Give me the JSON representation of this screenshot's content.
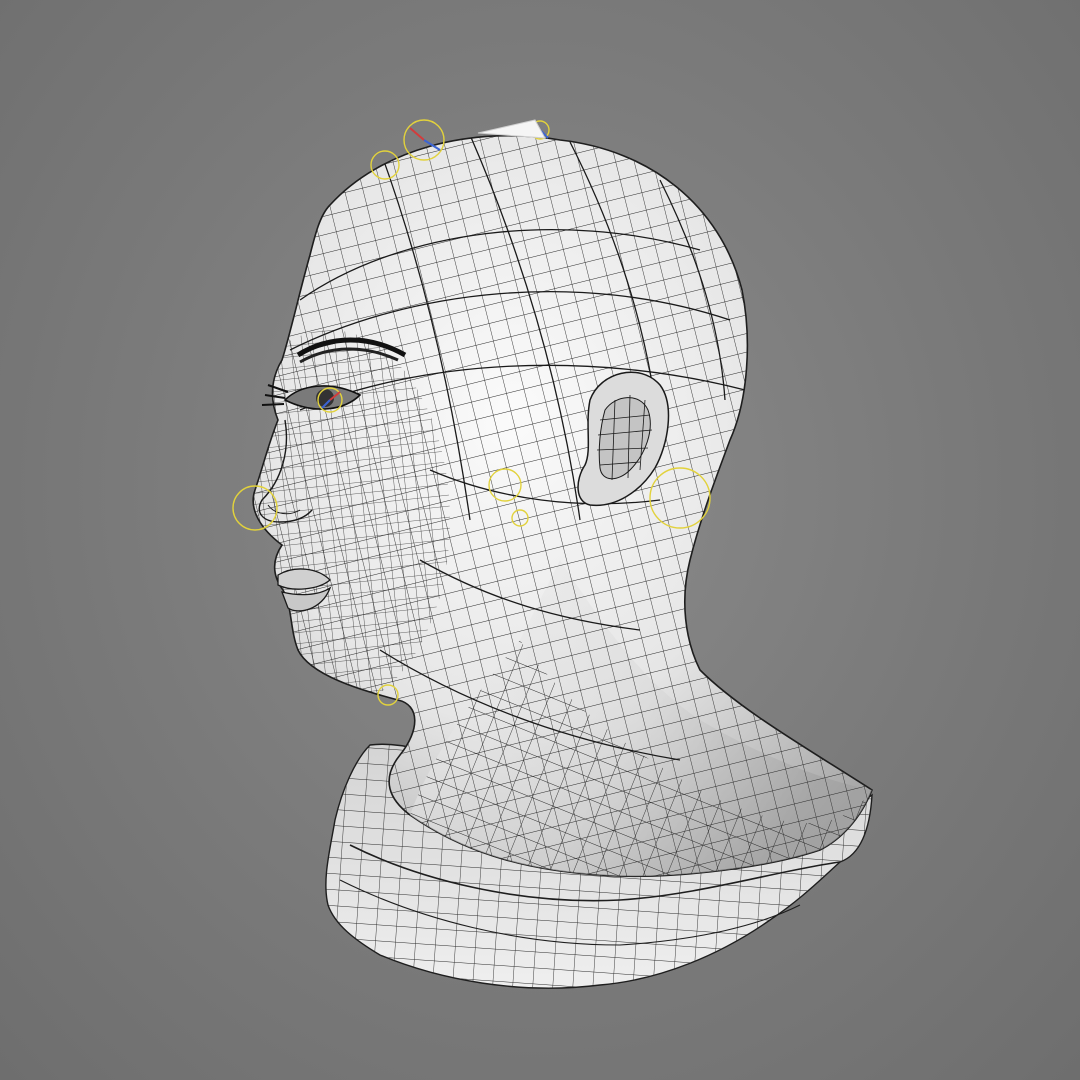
{
  "viewport": {
    "background_color": "#7b7b7b",
    "mesh_surface_color": "#ebebeb",
    "mesh_shadow_color": "#a9a9a9",
    "wire_color": "#1e1e1e",
    "rig_control_color": "#e2d23c",
    "axis_x_color": "#d23c3c",
    "axis_y_color": "#3c64d2"
  },
  "model": {
    "icon": "head-bust-mesh-icon"
  }
}
